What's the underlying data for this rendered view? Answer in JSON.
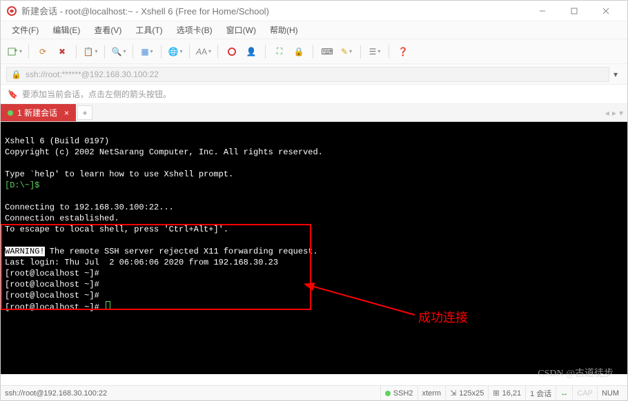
{
  "title": "新建会话 - root@localhost:~ - Xshell 6 (Free for Home/School)",
  "menu": [
    "文件(F)",
    "编辑(E)",
    "查看(V)",
    "工具(T)",
    "选项卡(B)",
    "窗口(W)",
    "帮助(H)"
  ],
  "address": "ssh://root:******@192.168.30.100:22",
  "tip": "要添加当前会话，点击左侧的箭头按钮。",
  "tab": {
    "label": "1 新建会话"
  },
  "term": {
    "l1": "Xshell 6 (Build 0197)",
    "l2": "Copyright (c) 2002 NetSarang Computer, Inc. All rights reserved.",
    "l3": "Type `help' to learn how to use Xshell prompt.",
    "prompt1": "[D:\\~]$",
    "l4": "Connecting to 192.168.30.100:22...",
    "l5": "Connection established.",
    "l6": "To escape to local shell, press 'Ctrl+Alt+]'.",
    "warn": "WARNING!",
    "warnrest": " The remote SSH server rejected X11 forwarding request.",
    "last": "Last login: Thu Jul  2 06:06:06 2020 from 192.168.30.23",
    "p": "[root@localhost ~]#"
  },
  "annot": "成功连接",
  "status": {
    "left": "ssh://root@192.168.30.100:22",
    "ssh": "SSH2",
    "term": "xterm",
    "size": "125x25",
    "cursor": "16,21",
    "sess": "1 会话",
    "cap": "CAP",
    "num": "NUM"
  },
  "watermark": "CSDN @古道徒步"
}
